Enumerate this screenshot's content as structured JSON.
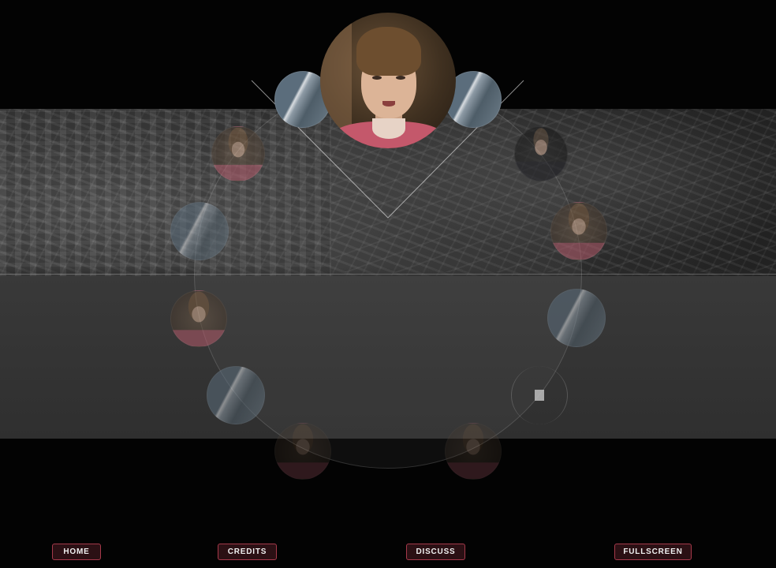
{
  "nav": {
    "home_label": "HOME",
    "credits_label": "CREDITS",
    "discuss_label": "DISCUSS",
    "fullscreen_label": "FULLSCREEN"
  },
  "colors": {
    "background": "#030303",
    "button_border": "#a5394a",
    "button_fill": "#2b1014",
    "button_text": "#f0f0f0"
  },
  "featured_video": {
    "subject": "young-woman-short-hair-portrait"
  },
  "thumbnails": [
    {
      "kind": "coast",
      "subject": "aerial-coastline"
    },
    {
      "kind": "coast",
      "subject": "aerial-coastline"
    },
    {
      "kind": "face",
      "subject": "young-woman-portrait"
    },
    {
      "kind": "man",
      "subject": "man-portrait"
    },
    {
      "kind": "coast",
      "subject": "aerial-coastline"
    },
    {
      "kind": "face",
      "subject": "young-woman-portrait"
    },
    {
      "kind": "face",
      "subject": "young-woman-portrait"
    },
    {
      "kind": "coast",
      "subject": "aerial-coastline"
    },
    {
      "kind": "coast",
      "subject": "aerial-coastline"
    },
    {
      "kind": "face",
      "subject": "young-woman-portrait"
    },
    {
      "kind": "face",
      "subject": "young-woman-portrait"
    }
  ]
}
